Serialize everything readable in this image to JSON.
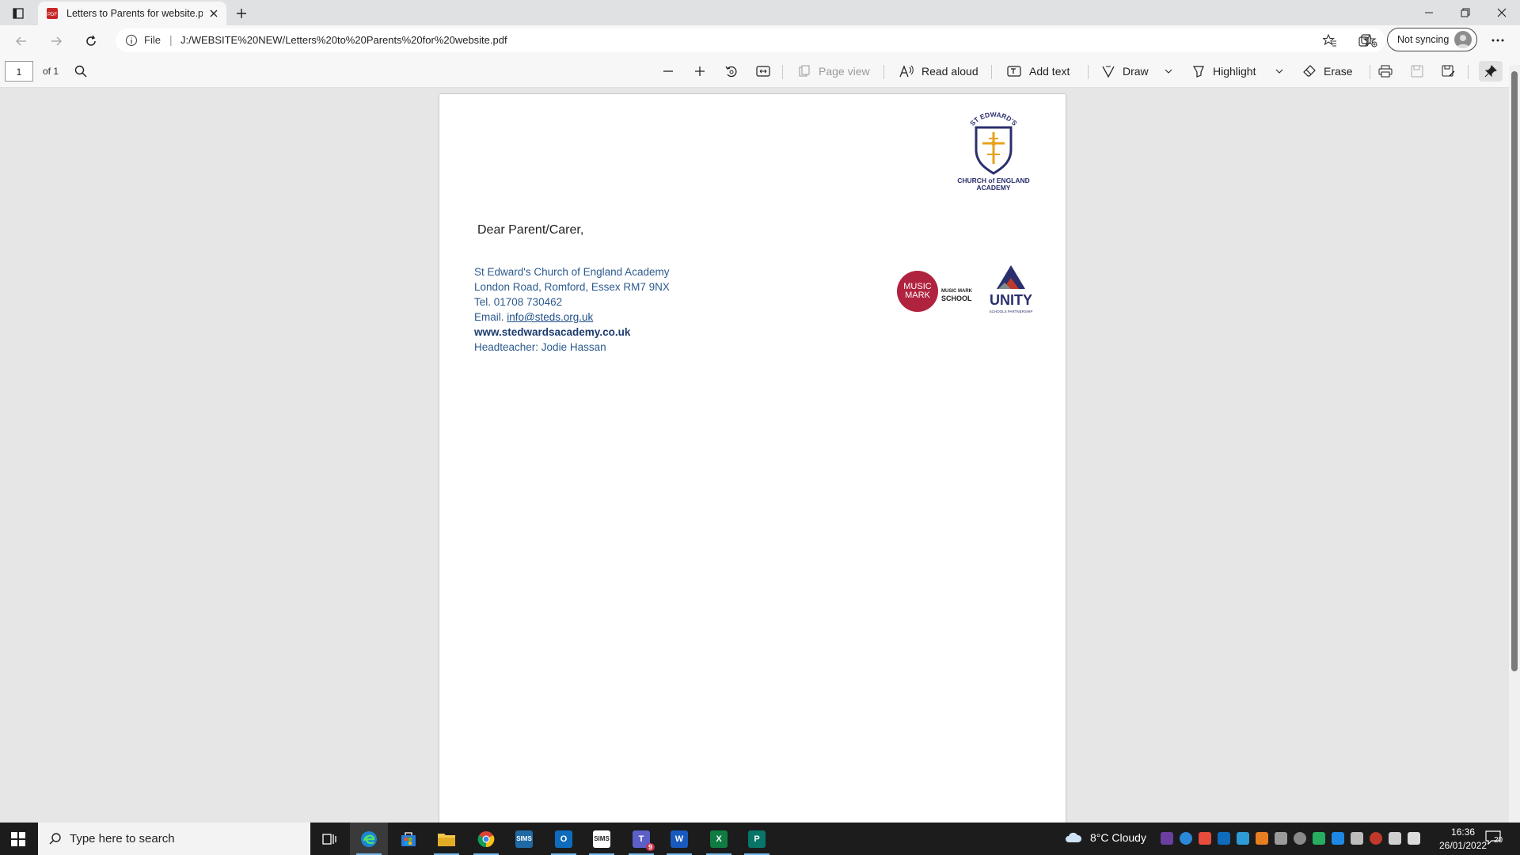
{
  "browser": {
    "tab_title": "Letters to Parents for website.pdf",
    "address_scheme": "File",
    "address_url": "J:/WEBSITE%20NEW/Letters%20to%20Parents%20for%20website.pdf",
    "sync_label": "Not syncing"
  },
  "pdf_toolbar": {
    "page_number": "1",
    "page_of": "of 1",
    "page_view": "Page view",
    "read_aloud": "Read aloud",
    "add_text": "Add text",
    "draw": "Draw",
    "highlight": "Highlight",
    "erase": "Erase"
  },
  "document": {
    "logo_top_text": "ST EDWARD'S",
    "logo_bottom_line1": "CHURCH of ENGLAND",
    "logo_bottom_line2": "ACADEMY",
    "greeting": "Dear Parent/Carer,",
    "address": {
      "line1": "St Edward's Church of England Academy",
      "line2": "London Road, Romford, Essex RM7 9NX",
      "line3": "Tel. 01708 730462",
      "email_prefix": "Email. ",
      "email": "info@steds.org.uk",
      "website": "www.stedwardsacademy.co.uk",
      "headteacher": "Headteacher: Jodie Hassan"
    },
    "musicmark_1": "MUSIC",
    "musicmark_2": "MARK",
    "musicmark_school_1": "MUSIC MARK",
    "musicmark_school_2": "SCHOOL",
    "unity": "UNITY",
    "unity_sub": "SCHOOLS PARTNERSHIP"
  },
  "taskbar": {
    "search_placeholder": "Type here to search",
    "weather": "8°C  Cloudy",
    "time": "16:36",
    "date": "26/01/2022",
    "notification_count": "20",
    "apps": [
      "task-view",
      "edge",
      "store",
      "file-explorer",
      "chrome",
      "sims",
      "outlook",
      "sims2",
      "teams",
      "word",
      "excel",
      "publisher"
    ],
    "app_labels": {
      "sims": "SIMS",
      "sims2": "SIMS",
      "outlook": "O",
      "teams": "T",
      "teams_badge": "9",
      "word": "W",
      "excel": "X",
      "publisher": "P"
    }
  },
  "colors": {
    "accent_blue": "#2c5a8e",
    "musicmark_red": "#b0233e",
    "taskbar": "#1c1c1c"
  }
}
